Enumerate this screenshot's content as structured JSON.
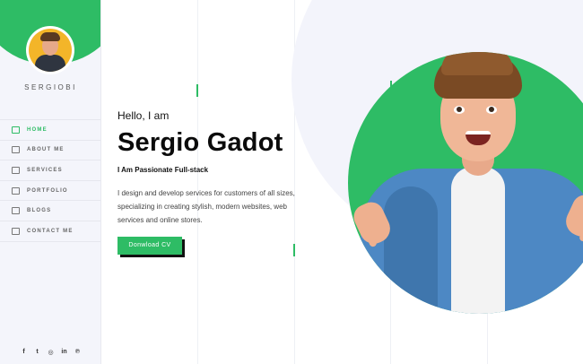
{
  "sidebar": {
    "brand": "SERGIOBI",
    "nav": [
      {
        "label": "HOME",
        "icon": "home-icon",
        "active": true
      },
      {
        "label": "ABOUT ME",
        "icon": "id-card-icon",
        "active": false
      },
      {
        "label": "SERVICES",
        "icon": "services-icon",
        "active": false
      },
      {
        "label": "PORTFOLIO",
        "icon": "portfolio-icon",
        "active": false
      },
      {
        "label": "BLOGS",
        "icon": "blog-icon",
        "active": false
      },
      {
        "label": "CONTACT ME",
        "icon": "contact-icon",
        "active": false
      }
    ],
    "socials": [
      {
        "icon": "facebook-icon",
        "glyph": "f"
      },
      {
        "icon": "twitter-icon",
        "glyph": "t"
      },
      {
        "icon": "instagram-icon",
        "glyph": "◎"
      },
      {
        "icon": "linkedin-icon",
        "glyph": "in"
      },
      {
        "icon": "pinterest-icon",
        "glyph": "℗"
      }
    ]
  },
  "hero": {
    "greeting": "Hello, I am",
    "name": "Sergio Gadot",
    "tagline": "I Am Passionate Full-stack",
    "description": "I design and develop services for customers of all sizes, specializing in creating stylish, modern websites, web services and online stores.",
    "cta_label": "Donwload CV"
  },
  "colors": {
    "accent": "#2ebc65",
    "sidebar_bg": "#f4f5fb",
    "text_dark": "#0b0b0b"
  }
}
